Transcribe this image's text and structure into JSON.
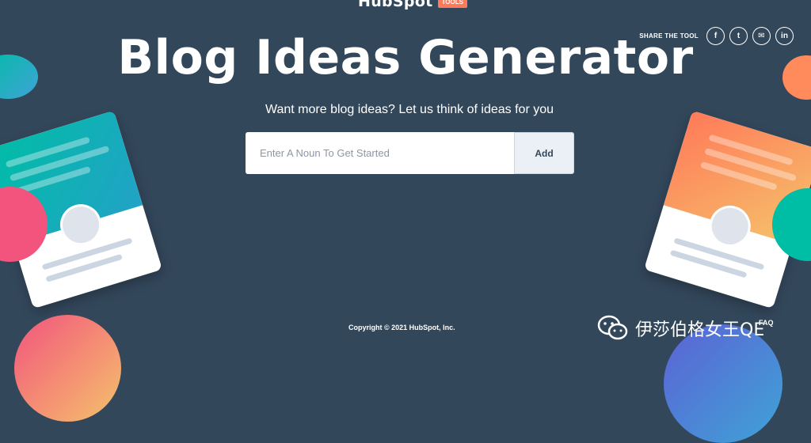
{
  "header": {
    "logo_text": "HubSpot",
    "logo_badge": "TOOLS"
  },
  "share": {
    "label": "SHARE THE TOOL",
    "buttons": [
      {
        "icon": "facebook-icon",
        "glyph": "f"
      },
      {
        "icon": "twitter-icon",
        "glyph": "t"
      },
      {
        "icon": "email-icon",
        "glyph": "✉"
      },
      {
        "icon": "linkedin-icon",
        "glyph": "in"
      }
    ]
  },
  "main": {
    "title": "Blog Ideas Generator",
    "subtitle": "Want more blog ideas? Let us think of ideas for you",
    "input_placeholder": "Enter A Noun To Get Started",
    "input_value": "",
    "add_button": "Add"
  },
  "footer": {
    "copyright": "Copyright © 2021 HubSpot, Inc.",
    "faq_label": "FAQ"
  },
  "watermark": {
    "text": "伊莎伯格女王QE"
  },
  "colors": {
    "background": "#33475b",
    "accent_orange": "#ff7a59",
    "teal": "#00bda5",
    "pink": "#f2547d",
    "yellow": "#f5c26b"
  }
}
